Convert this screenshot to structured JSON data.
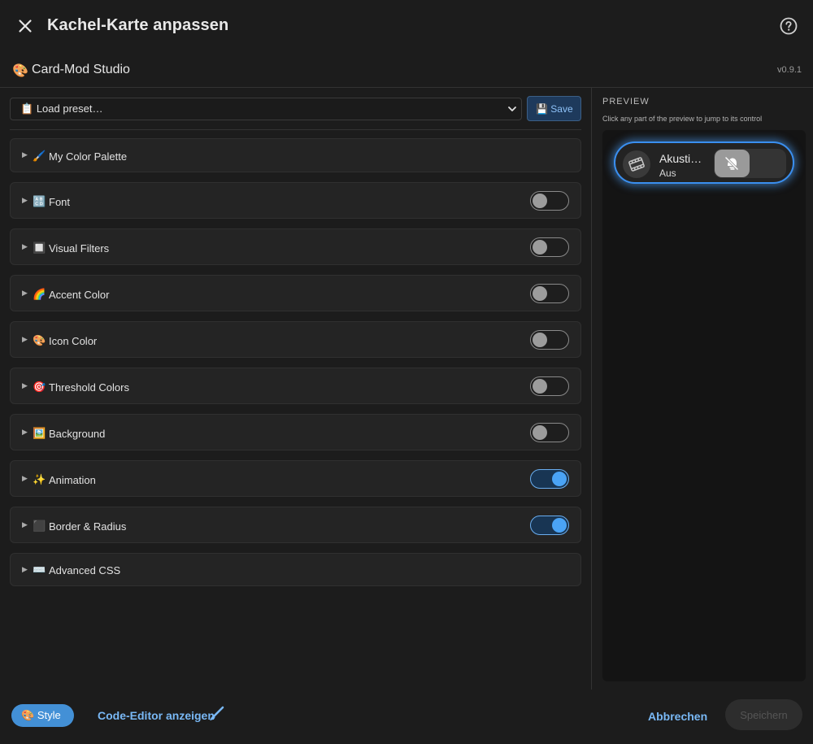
{
  "header": {
    "title": "Kachel-Karte anpassen",
    "close_icon": "close-icon",
    "help_icon": "help-circle-icon"
  },
  "studio": {
    "emoji": "🎨",
    "name": "Card-Mod Studio",
    "version": "v0.9.1"
  },
  "preset": {
    "emoji": "📋",
    "selected": "Load preset…",
    "save_emoji": "💾",
    "save_label": "Save"
  },
  "sections": [
    {
      "emoji": "🖌️",
      "label": "My Color Palette",
      "has_toggle": false
    },
    {
      "emoji": "🔠",
      "label": "Font",
      "has_toggle": true,
      "enabled": false
    },
    {
      "emoji": "🔲",
      "label": "Visual Filters",
      "has_toggle": true,
      "enabled": false
    },
    {
      "emoji": "🌈",
      "label": "Accent Color",
      "has_toggle": true,
      "enabled": false
    },
    {
      "emoji": "🎨",
      "label": "Icon Color",
      "has_toggle": true,
      "enabled": false
    },
    {
      "emoji": "🎯",
      "label": "Threshold Colors",
      "has_toggle": true,
      "enabled": false
    },
    {
      "emoji": "🖼️",
      "label": "Background",
      "has_toggle": true,
      "enabled": false
    },
    {
      "emoji": "✨",
      "label": "Animation",
      "has_toggle": true,
      "enabled": true
    },
    {
      "emoji": "⬛",
      "label": "Border & Radius",
      "has_toggle": true,
      "enabled": true
    },
    {
      "emoji": "⌨️",
      "label": "Advanced CSS",
      "has_toggle": false
    }
  ],
  "preview": {
    "title": "PREVIEW",
    "subtitle": "Click any part of the preview to jump to its control",
    "tile": {
      "name": "Akusti…",
      "state": "Aus",
      "icon": "film-icon",
      "switch_icon": "motion-sensor-off-icon"
    }
  },
  "footer": {
    "style_emoji": "🎨",
    "style_label": "Style",
    "code_editor_label": "Code-Editor anzeigen",
    "cancel_label": "Abbrechen",
    "save_label": "Speichern"
  },
  "colors": {
    "accent": "#4aa3f5",
    "link": "#79b8f5",
    "background": "#1c1c1c",
    "section_bg": "#242424"
  }
}
